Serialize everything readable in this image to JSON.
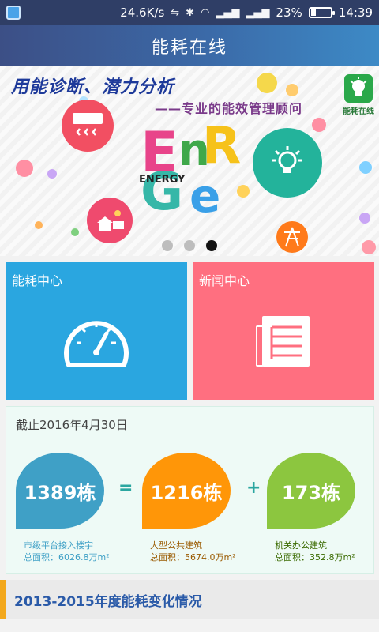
{
  "status": {
    "net_speed": "24.6K/s",
    "battery_percent": "23%",
    "battery_level": 0.23,
    "time": "14:39"
  },
  "app": {
    "title": "能耗在线"
  },
  "banner": {
    "headline": "用能诊断、潜力分析",
    "subline": "——专业的能效管理顾问",
    "energy_word": "ENERGY",
    "app_badge_label": "能耗在线",
    "active_page": 3,
    "page_count": 3
  },
  "tiles": [
    {
      "label": "能耗中心",
      "icon": "gauge-icon",
      "color": "#2aa6e0"
    },
    {
      "label": "新闻中心",
      "icon": "newspaper-icon",
      "color": "#ff6f80"
    }
  ],
  "summary": {
    "date_label": "截止2016年4月30日",
    "total": {
      "value": "1389栋",
      "caption": "市级平台接入楼宇",
      "area": "总面积：6026.8万m²",
      "color": "#3fa0c6"
    },
    "public": {
      "value": "1216栋",
      "caption": "大型公共建筑",
      "area": "总面积：5674.0万m²",
      "color": "#ff9608"
    },
    "office": {
      "value": "173栋",
      "caption": "机关办公建筑",
      "area": "总面积：352.8万m²",
      "color": "#8cc63f"
    },
    "op_equals": "=",
    "op_plus": "+"
  },
  "section": {
    "title": "2013-2015年度能耗变化情况"
  }
}
